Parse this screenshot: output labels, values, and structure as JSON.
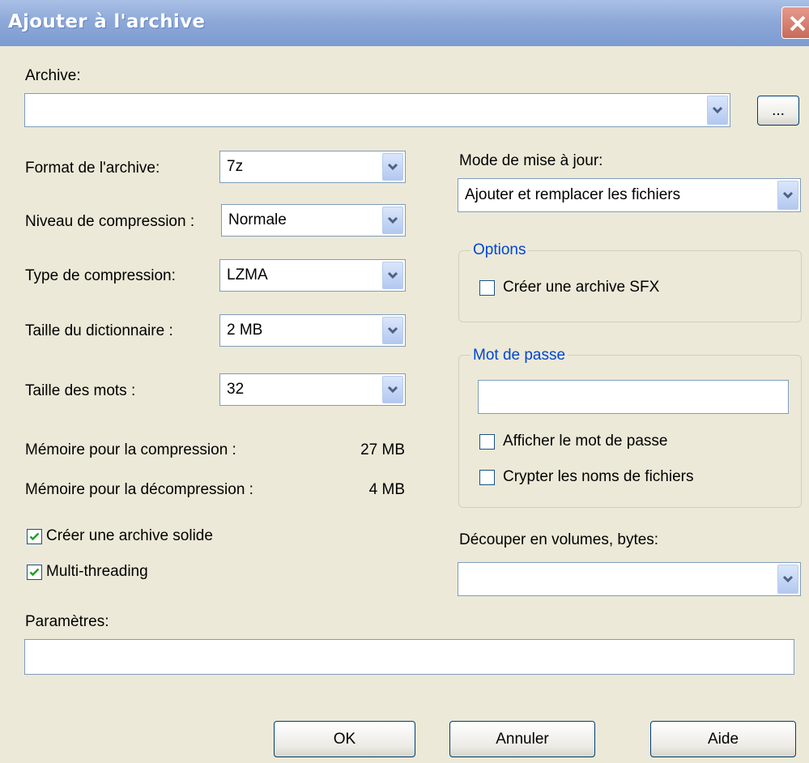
{
  "window": {
    "title": "Ajouter à l'archive"
  },
  "archive": {
    "label": "Archive:",
    "value": "",
    "browse_label": "..."
  },
  "format": {
    "label": "Format de l'archive:",
    "value": "7z"
  },
  "level": {
    "label": "Niveau de compression :",
    "value": "Normale"
  },
  "method": {
    "label": "Type de compression:",
    "value": "LZMA"
  },
  "dictionary": {
    "label": "Taille du dictionnaire :",
    "value": "2 MB"
  },
  "word_size": {
    "label": "Taille des mots :",
    "value": "32"
  },
  "memory": {
    "compress_label": "Mémoire pour la compression :",
    "compress_value": "27 MB",
    "decompress_label": "Mémoire pour la décompression :",
    "decompress_value": "4 MB"
  },
  "checkboxes": {
    "solid_label": "Créer une archive solide",
    "solid_checked": true,
    "multithread_label": "Multi-threading",
    "multithread_checked": true
  },
  "parameters": {
    "label": "Paramètres:",
    "value": ""
  },
  "update_mode": {
    "label": "Mode de mise à jour:",
    "value": "Ajouter et remplacer les fichiers"
  },
  "options": {
    "title": "Options",
    "sfx_label": "Créer une archive SFX",
    "sfx_checked": false
  },
  "password": {
    "title": "Mot de passe",
    "value": "",
    "show_label": "Afficher le mot de passe",
    "show_checked": false,
    "encrypt_names_label": "Crypter les noms de fichiers",
    "encrypt_names_checked": false
  },
  "volumes": {
    "label": "Découper en volumes, bytes:",
    "value": ""
  },
  "buttons": {
    "ok": "OK",
    "cancel": "Annuler",
    "help": "Aide"
  }
}
